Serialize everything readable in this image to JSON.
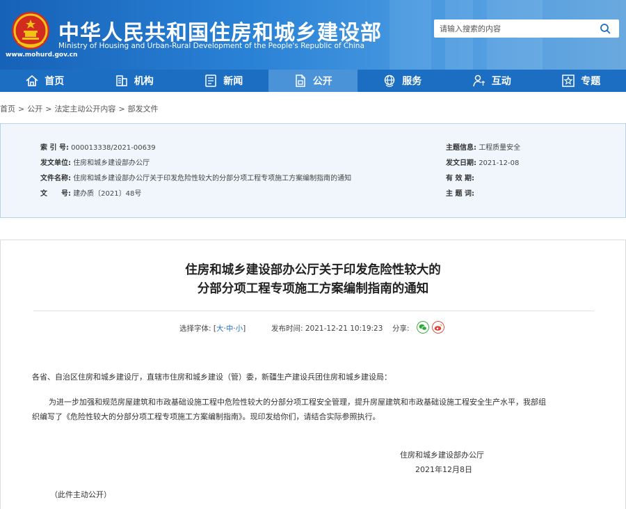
{
  "header": {
    "title": "中华人民共和国住房和城乡建设部",
    "subtitle": "Ministry of Housing and Urban-Rural Development of the People's Republic of China",
    "url": "www.mohurd.gov.cn",
    "search_placeholder": "请输入搜索的内容",
    "brand_color": "#1b6ec2"
  },
  "nav": {
    "items": [
      {
        "label": "首页",
        "icon": "home-icon"
      },
      {
        "label": "机构",
        "icon": "building-icon"
      },
      {
        "label": "新闻",
        "icon": "news-icon"
      },
      {
        "label": "公开",
        "icon": "document-icon",
        "active": true
      },
      {
        "label": "服务",
        "icon": "globe-icon"
      },
      {
        "label": "互动",
        "icon": "user-icon"
      },
      {
        "label": "专题",
        "icon": "star-icon"
      }
    ]
  },
  "breadcrumb": [
    "首页",
    "公开",
    "法定主动公开内容",
    "部发文件"
  ],
  "meta": {
    "index_label": "索 引 号:",
    "index_value": "000013338/2021-00639",
    "issuer_label": "发文单位:",
    "issuer_value": "住房和城乡建设部办公厅",
    "filename_label": "文件名称:",
    "filename_value": "住房和城乡建设部办公厅关于印发危险性较大的分部分项工程专项施工方案编制指南的通知",
    "docno_label": "文　　号:",
    "docno_value": "建办质〔2021〕48号",
    "topic_label": "主题信息:",
    "topic_value": "工程质量安全",
    "date_label": "发文日期:",
    "date_value": "2021-12-08",
    "validity_label": "有 效 期:",
    "keywords_label": "主 题 词:"
  },
  "article": {
    "title_line1": "住房和城乡建设部办公厅关于印发危险性较大的",
    "title_line2": "分部分项工程专项施工方案编制指南的通知",
    "font_label": "选择字体: [",
    "font_large": "大",
    "font_medium": "中",
    "font_small": "小",
    "font_close": "]",
    "publish_label": "发布时间: 2021-12-21 10:19:23",
    "share_label": "分享:",
    "salutation": "各省、自治区住房和城乡建设厅，直辖市住房和城乡建设（管）委，新疆生产建设兵团住房和城乡建设局：",
    "para1_line1": "为进一步加强和规范房屋建筑和市政基础设施工程中危险性较大的分部分项工程安全管理，提升房屋建筑和市政基础设施工程安全生产水平，我部组",
    "para1_line2": "织编写了《危险性较大的分部分项工程专项施工方案编制指南》。现印发给你们，请结合实际参照执行。",
    "signature": "住房和城乡建设部办公厅",
    "sign_date": "2021年12月8日",
    "note": "（此件主动公开）"
  }
}
